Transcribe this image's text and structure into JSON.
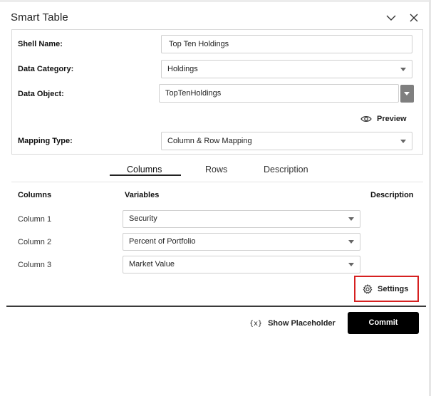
{
  "panel": {
    "title": "Smart Table",
    "collapse_icon": "chevron-down-icon",
    "close_icon": "close-icon"
  },
  "form": {
    "shell_name": {
      "label": "Shell Name:",
      "value": "Top Ten Holdings"
    },
    "data_category": {
      "label": "Data Category:",
      "value": "Holdings"
    },
    "data_object": {
      "label": "Data Object:",
      "value": "TopTenHoldings"
    },
    "preview_label": "Preview",
    "mapping_type": {
      "label": "Mapping Type:",
      "value": "Column & Row Mapping"
    }
  },
  "tabs": [
    {
      "label": "Columns",
      "active": true
    },
    {
      "label": "Rows",
      "active": false
    },
    {
      "label": "Description",
      "active": false
    }
  ],
  "table": {
    "headers": {
      "columns": "Columns",
      "variables": "Variables",
      "description": "Description"
    },
    "rows": [
      {
        "column": "Column 1",
        "variable": "Security"
      },
      {
        "column": "Column 2",
        "variable": "Percent of Portfolio"
      },
      {
        "column": "Column 3",
        "variable": "Market Value"
      }
    ]
  },
  "settings_label": "Settings",
  "footer": {
    "placeholder_icon": "{x}",
    "placeholder_label": "Show Placeholder",
    "commit_label": "Commit"
  },
  "colors": {
    "highlight": "#d62020",
    "commit_bg": "#000000",
    "accent_gray": "#7f7f7f"
  }
}
